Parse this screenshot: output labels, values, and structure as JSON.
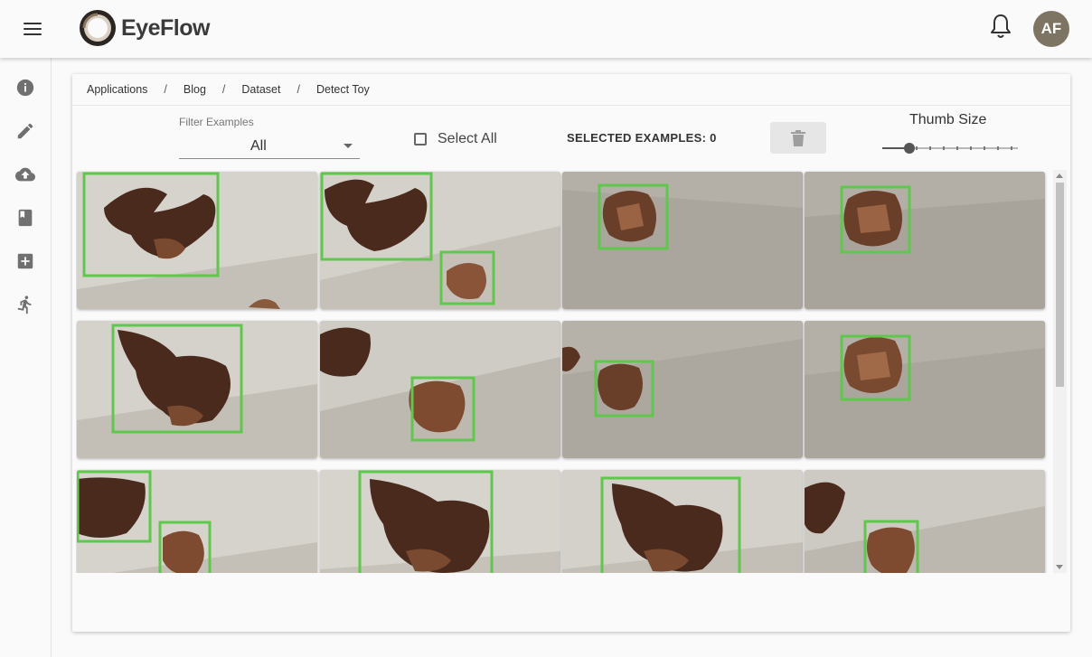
{
  "app": {
    "name": "EyeFlow",
    "user_initials": "AF"
  },
  "colors": {
    "accent_box": "#5ec84b",
    "avatar_bg": "#7e7464",
    "icon_gray": "#707070"
  },
  "sidebar": {
    "items": [
      {
        "name": "info-icon"
      },
      {
        "name": "pencil-icon"
      },
      {
        "name": "cloud-upload-icon"
      },
      {
        "name": "book-icon"
      },
      {
        "name": "add-box-icon"
      },
      {
        "name": "run-icon"
      }
    ]
  },
  "breadcrumb": [
    "Applications",
    "Blog",
    "Dataset",
    "Detect Toy"
  ],
  "breadcrumb_separator": "/",
  "toolbar": {
    "filter_label": "Filter Examples",
    "filter_value": "All",
    "select_all_label": "Select All",
    "selected_examples": "SELECTED EXAMPLES: 0",
    "thumb_size_label": "Thumb Size",
    "thumb_size_value": 0.2
  },
  "gallery": {
    "rows": 3,
    "columns": 4,
    "visible_thumbnails": 12
  }
}
